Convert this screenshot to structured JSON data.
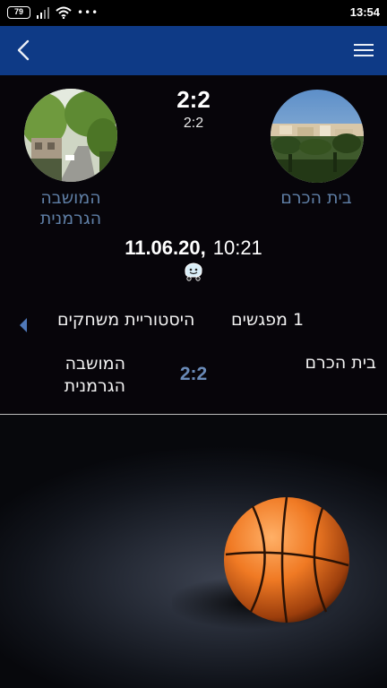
{
  "status_bar": {
    "battery": "79",
    "time": "13:54",
    "more": "•••"
  },
  "app_bar": {
    "back_icon": "chevron-left-icon",
    "menu_icon": "hamburger-menu-icon"
  },
  "match": {
    "home_team": {
      "name": "בית הכרם"
    },
    "away_team": {
      "name": "המושבה הגרמנית"
    },
    "score": "2:2",
    "score_secondary": "2:2",
    "date": "11.06.20,",
    "time": "10:21",
    "navigation_icon": "waze-icon"
  },
  "tabs": {
    "meetings": "1 מפגשים",
    "history": "היסטוריית משחקים",
    "arrow_icon": "triangle-left-icon"
  },
  "head_to_head": {
    "home": "בית הכרם",
    "score": "2:2",
    "away": "המושבה הגרמנית"
  },
  "background": {
    "image": "basketball-on-floor"
  },
  "colors": {
    "app_bar": "#0e3a86",
    "team_name": "#5f7fa6",
    "h2h_score": "#6a8bb8",
    "background": "#07050a"
  }
}
